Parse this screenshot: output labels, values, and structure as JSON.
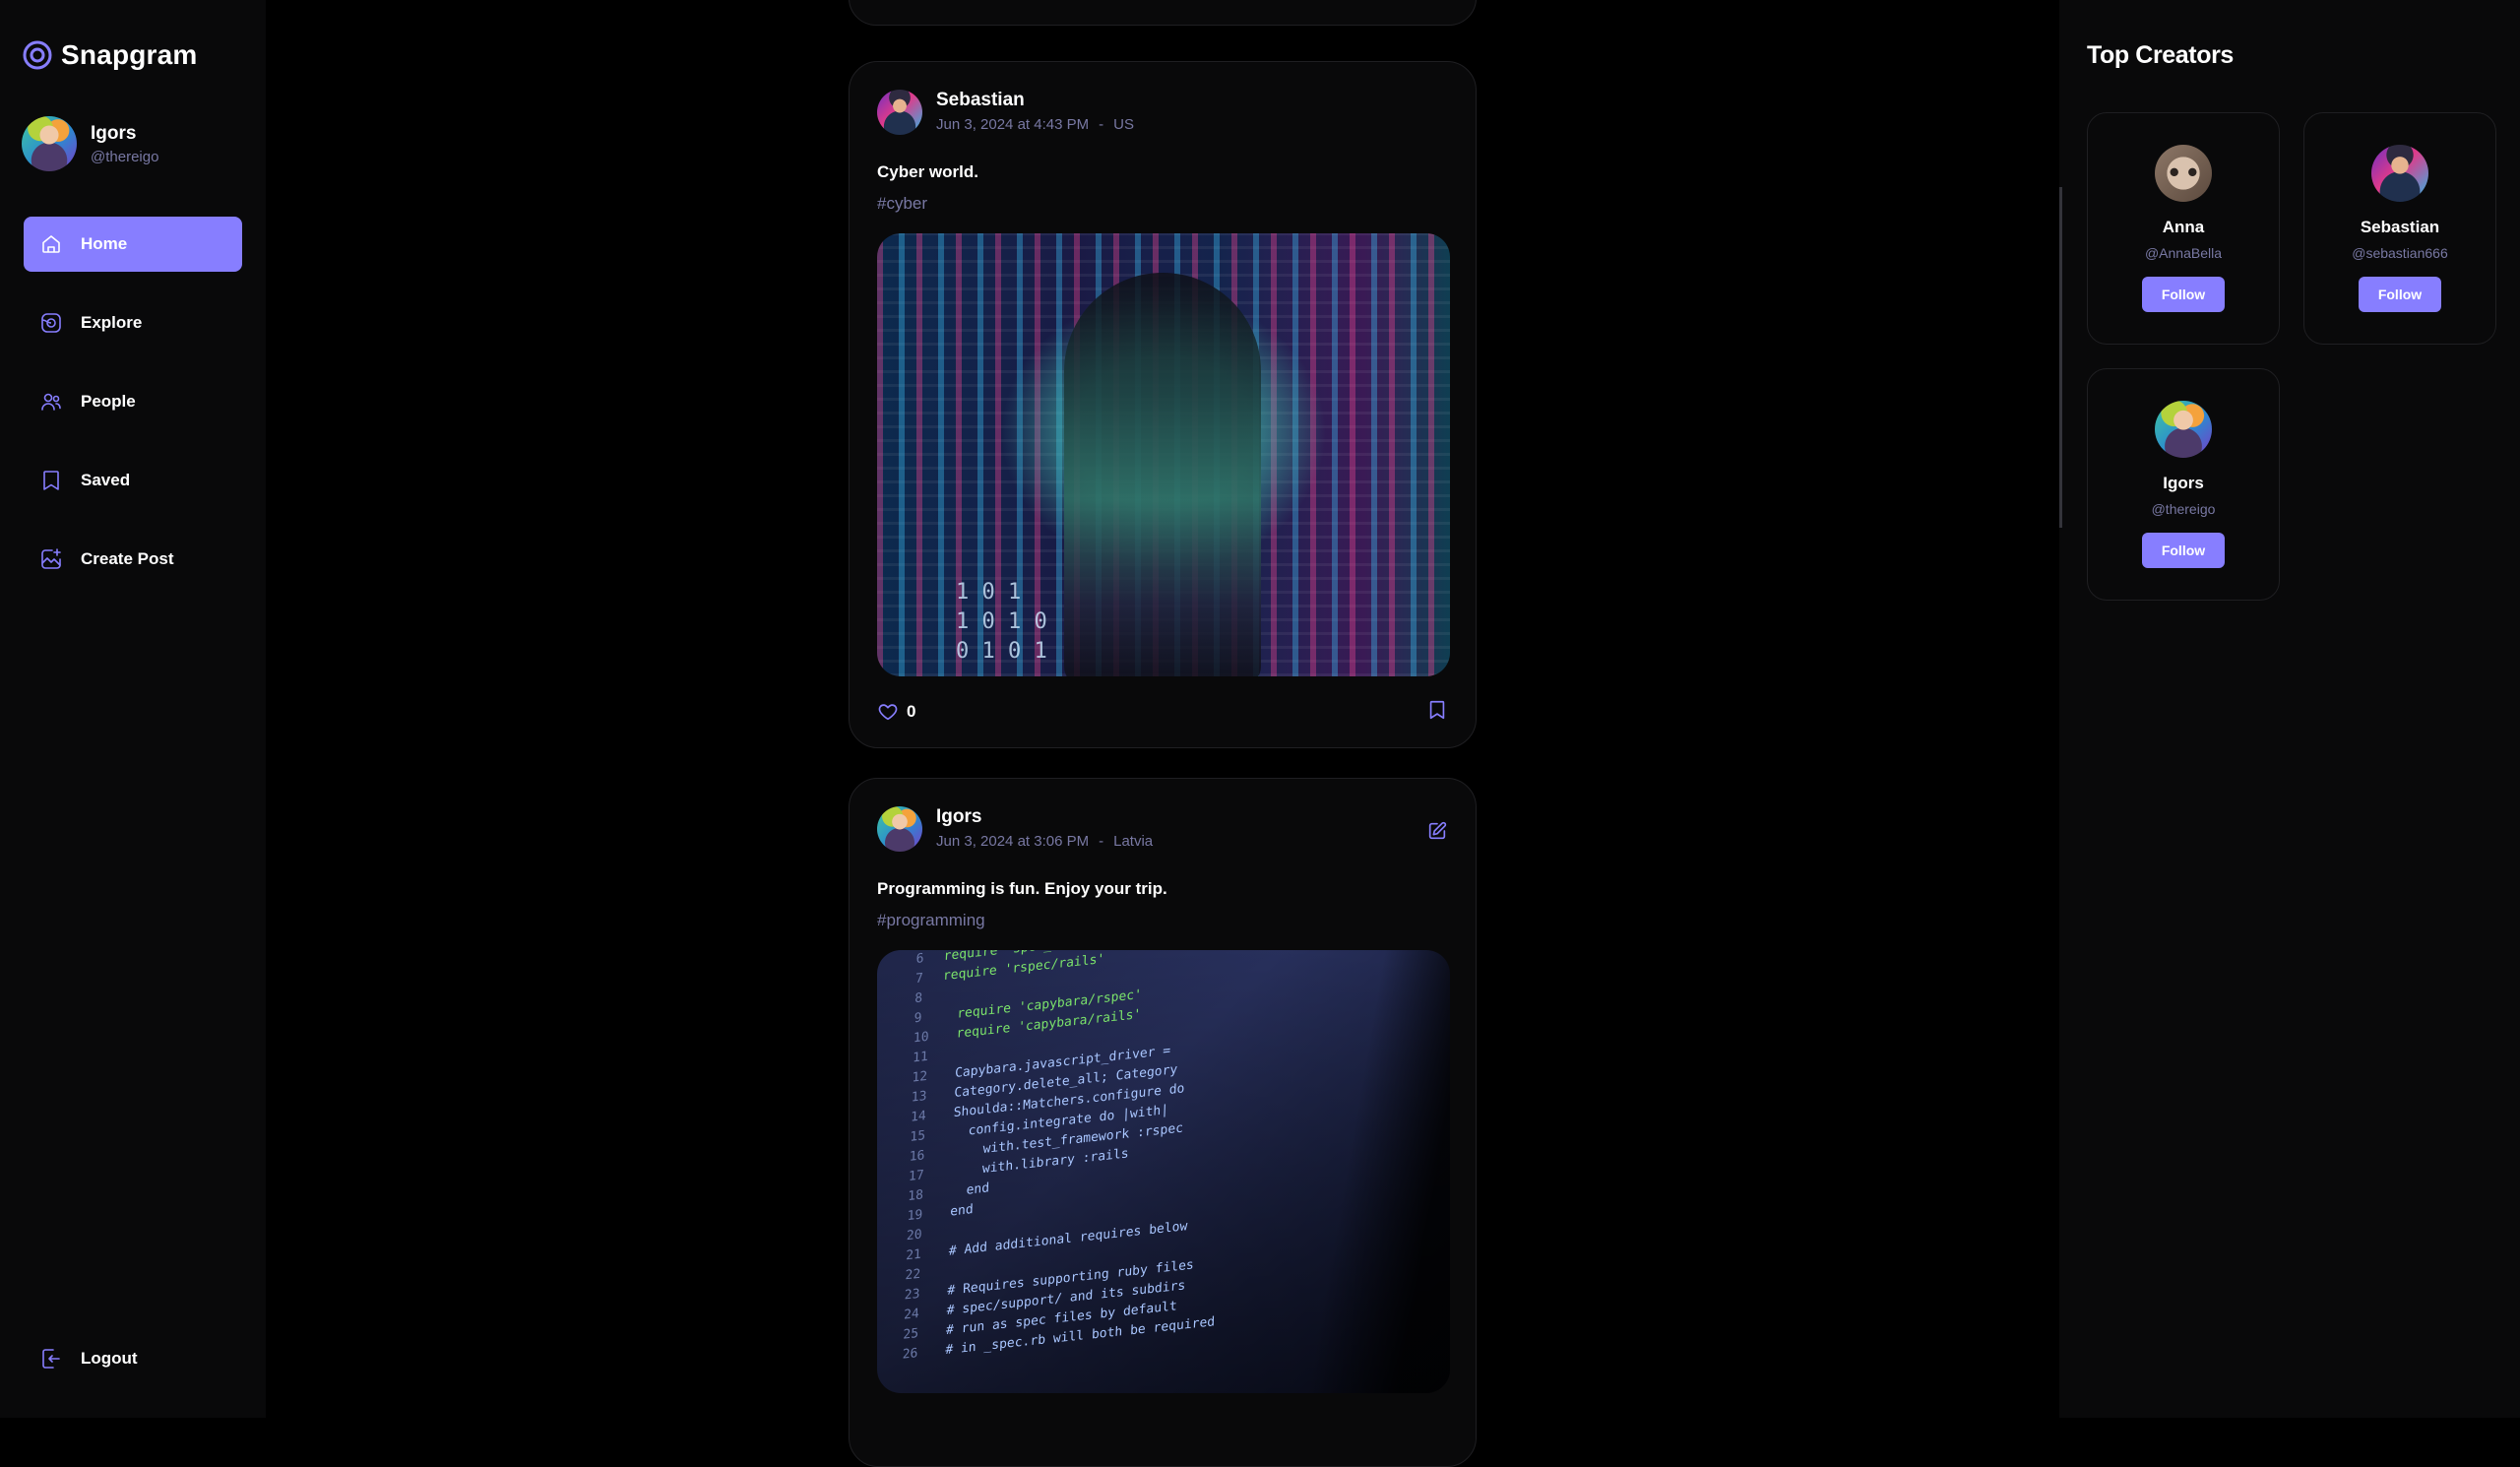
{
  "app": {
    "name": "Snapgram",
    "accent_color": "#877eff",
    "muted_text_color": "#7878a3"
  },
  "user": {
    "name": "Igors",
    "handle": "@thereigo"
  },
  "nav": {
    "items": [
      {
        "label": "Home",
        "icon": "home-icon",
        "active": true
      },
      {
        "label": "Explore",
        "icon": "explore-icon",
        "active": false
      },
      {
        "label": "People",
        "icon": "people-icon",
        "active": false
      },
      {
        "label": "Saved",
        "icon": "bookmark-icon",
        "active": false
      },
      {
        "label": "Create Post",
        "icon": "create-post-icon",
        "active": false
      }
    ],
    "logout_label": "Logout"
  },
  "feed": {
    "posts": [
      {
        "author": "Sebastian",
        "date": "Jun 3, 2024 at 4:43 PM",
        "separator": "-",
        "location": "US",
        "caption": "Cyber world.",
        "tag": "#cyber",
        "likes": "0",
        "editable": false
      },
      {
        "author": "Igors",
        "date": "Jun 3, 2024 at 3:06 PM",
        "separator": "-",
        "location": "Latvia",
        "caption": "Programming is fun. Enjoy your trip.",
        "tag": "#programming",
        "editable": true
      }
    ]
  },
  "top_creators": {
    "title": "Top Creators",
    "creators": [
      {
        "name": "Anna",
        "handle": "@AnnaBella",
        "button": "Follow"
      },
      {
        "name": "Sebastian",
        "handle": "@sebastian666",
        "button": "Follow"
      },
      {
        "name": "Igors",
        "handle": "@thereigo",
        "button": "Follow"
      }
    ]
  }
}
